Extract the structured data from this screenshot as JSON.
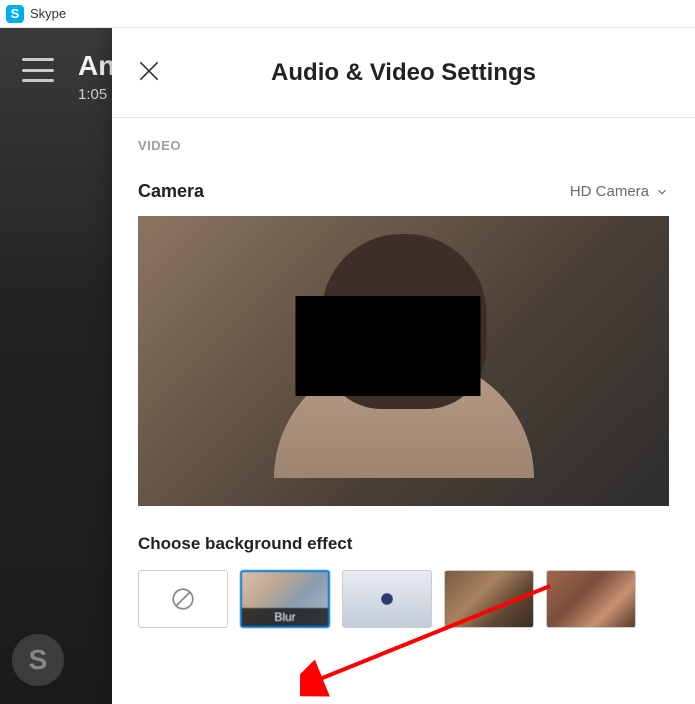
{
  "titlebar": {
    "icon_letter": "S",
    "app_name": "Skype"
  },
  "background": {
    "name_partial": "An",
    "call_time": "1:05",
    "avatar_letter": "S"
  },
  "panel": {
    "title": "Audio & Video Settings",
    "section": "VIDEO",
    "camera_label": "Camera",
    "camera_selected": "HD Camera",
    "effect_title": "Choose background effect",
    "effects": {
      "none": "",
      "blur": "Blur"
    }
  }
}
